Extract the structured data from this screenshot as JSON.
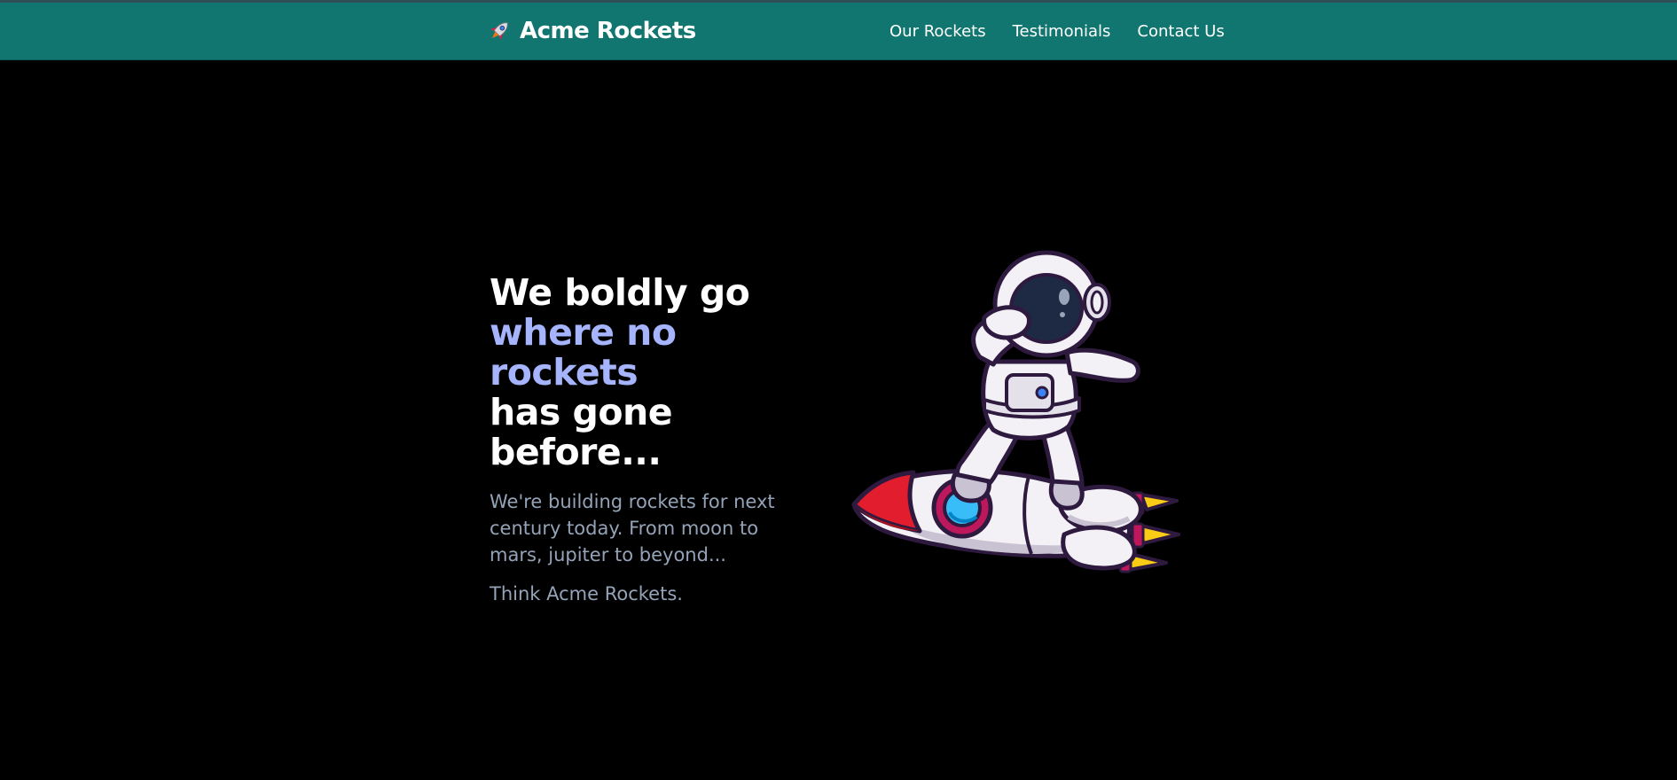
{
  "header": {
    "brand_title": "Acme Rockets",
    "logo_icon": "rocket-icon",
    "nav": [
      {
        "label": "Our Rockets"
      },
      {
        "label": "Testimonials"
      },
      {
        "label": "Contact Us"
      }
    ]
  },
  "hero": {
    "headline": {
      "line1": "We boldly go",
      "line2": "where no rockets",
      "line3": "has gone",
      "line4": "before..."
    },
    "subtitle": "We're building rockets for next century today. From moon to mars, jupiter to beyond...",
    "tagline": "Think Acme Rockets.",
    "illustration": "astronaut-dabbing-on-rocket"
  },
  "colors": {
    "header_bg": "#11766f",
    "page_bg": "#000000",
    "accent_text": "#a5b4fc",
    "muted_text": "#94a3b8"
  }
}
